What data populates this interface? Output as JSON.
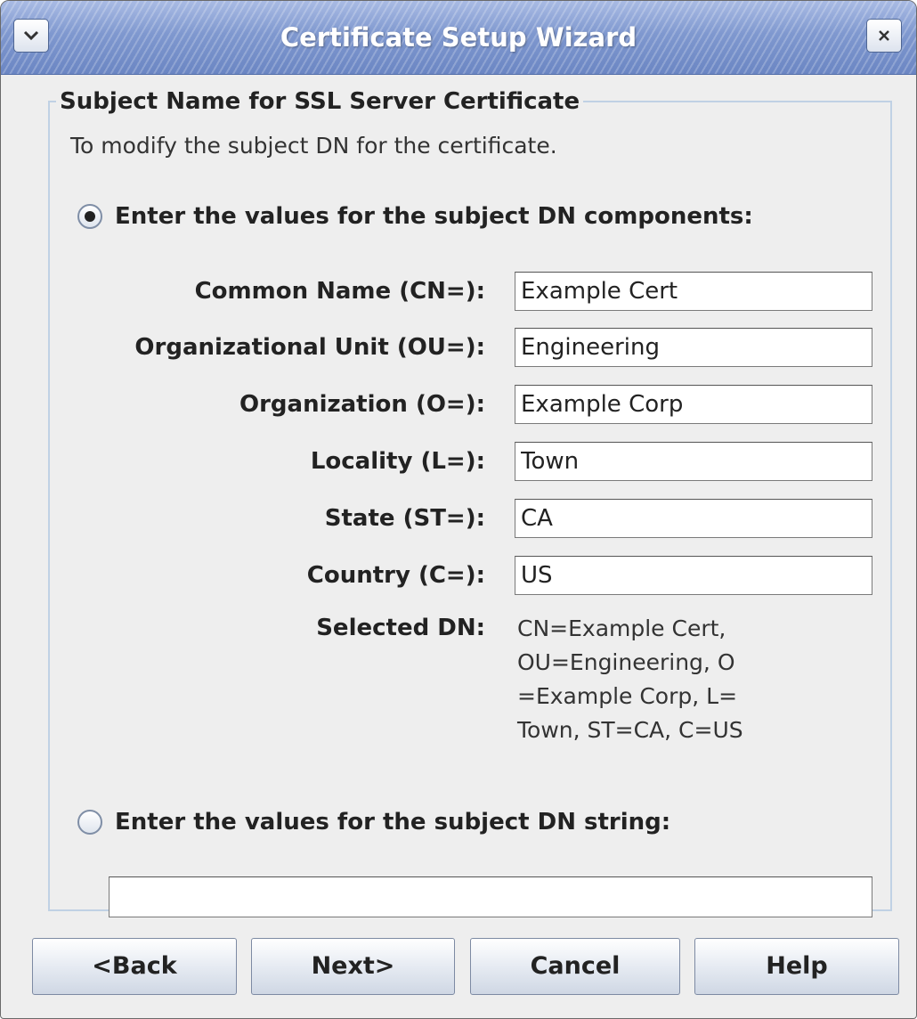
{
  "window": {
    "title": "Certificate Setup Wizard"
  },
  "group": {
    "title": "Subject Name for SSL Server Certificate",
    "description": "To modify the subject DN for the certificate."
  },
  "options": {
    "components": {
      "label": "Enter the values for the subject DN components:",
      "selected": true
    },
    "string": {
      "label": "Enter the values for the subject DN string:",
      "selected": false,
      "value": ""
    }
  },
  "fields": [
    {
      "label": "Common Name (CN=):",
      "value": "Example Cert"
    },
    {
      "label": "Organizational Unit (OU=):",
      "value": "Engineering"
    },
    {
      "label": "Organization (O=):",
      "value": "Example Corp"
    },
    {
      "label": "Locality (L=):",
      "value": "Town"
    },
    {
      "label": "State (ST=):",
      "value": "CA"
    },
    {
      "label": "Country (C=):",
      "value": "US"
    }
  ],
  "selected_dn": {
    "label": "Selected DN:",
    "value": "CN=Example Cert, OU=Engineering, O=Example Corp, L=Town, ST=CA, C=US"
  },
  "buttons": {
    "back": "<Back",
    "next": "Next>",
    "cancel": "Cancel",
    "help": "Help"
  },
  "icons": {
    "menu": "chevron-down-icon",
    "close": "close-icon"
  }
}
